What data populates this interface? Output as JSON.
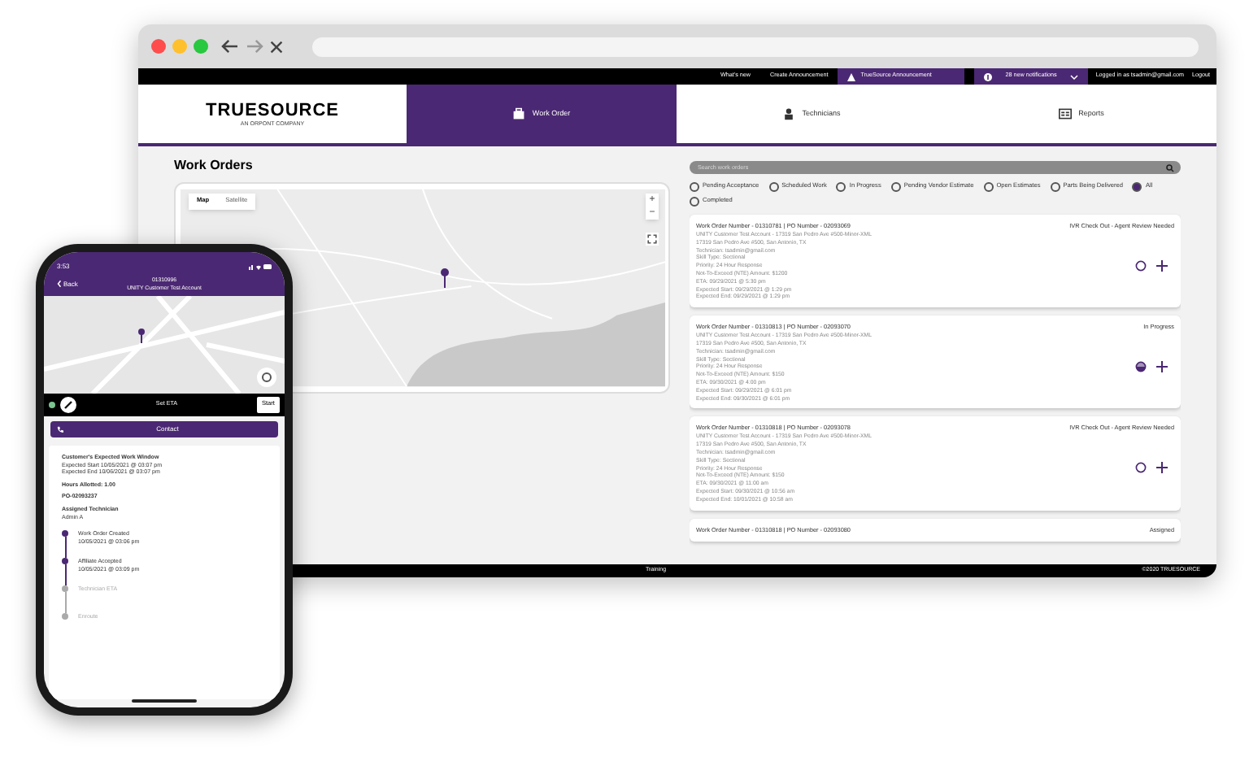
{
  "top_bar": {
    "links": [
      "What's new",
      "Create Announcement"
    ],
    "announcement": "TrueSource Announcement",
    "notifications": "28 new notifications",
    "user": "Logged in as tsadmin@gmail.com",
    "logout": "Logout"
  },
  "logo": {
    "name": "TRUESOURCE",
    "tagline": "AN ORPONT COMPANY"
  },
  "nav": [
    {
      "label": "Work Order",
      "selected": true
    },
    {
      "label": "Technicians",
      "selected": false
    },
    {
      "label": "Reports",
      "selected": false
    }
  ],
  "page_title": "Work Orders",
  "map": {
    "tabs": [
      {
        "label": "Map",
        "selected": true
      },
      {
        "label": "Satellite",
        "selected": false
      }
    ],
    "zoom_in": "+",
    "zoom_out": "−"
  },
  "search": {
    "placeholder": "Search work orders"
  },
  "filters": [
    {
      "label": "Pending Acceptance",
      "selected": false
    },
    {
      "label": "Scheduled Work",
      "selected": false
    },
    {
      "label": "In Progress",
      "selected": false
    },
    {
      "label": "Pending Vendor Estimate",
      "selected": false
    },
    {
      "label": "Open Estimates",
      "selected": false
    },
    {
      "label": "Parts Being Delivered",
      "selected": false
    },
    {
      "label": "All",
      "selected": true
    },
    {
      "label": "Completed",
      "selected": false
    }
  ],
  "work_orders": [
    {
      "title": "Work Order Number - 01310781 | PO Number - 02093069",
      "status": "IVR Check Out - Agent Review Needed",
      "in_progress": false,
      "lines": [
        "UNITY Customer Test Account - 17319 San Pedro Ave #500-Minor-XML",
        "17319 San Pedro Ave #500, San Antonio, TX",
        "Technician: tsadmin@gmail.com",
        "Skill Type: Sectional",
        "Priority: 24 Hour Response",
        "Not-To-Exceed (NTE) Amount: $1200",
        "ETA: 09/29/2021 @ 5:30 pm",
        "Expected Start: 09/29/2021 @ 1:29 pm",
        "Expected End: 09/29/2021 @ 1:29 pm"
      ]
    },
    {
      "title": "Work Order Number - 01310813 | PO Number - 02093070",
      "status": "In Progress",
      "in_progress": true,
      "lines": [
        "UNITY Customer Test Account - 17319 San Pedro Ave #500-Minor-XML",
        "17319 San Pedro Ave #500, San Antonio, TX",
        "Technician: tsadmin@gmail.com",
        "Skill Type: Sectional",
        "Priority: 24 Hour Response",
        "Not-To-Exceed (NTE) Amount: $150",
        "ETA: 09/30/2021 @ 4:00 pm",
        "Expected Start: 09/29/2021 @ 6:01 pm",
        "Expected End: 09/30/2021 @ 6:01 pm"
      ]
    },
    {
      "title": "Work Order Number - 01310818 | PO Number - 02093078",
      "status": "IVR Check Out - Agent Review Needed",
      "in_progress": false,
      "lines": [
        "UNITY Customer Test Account - 17319 San Pedro Ave #500-Minor-XML",
        "17319 San Pedro Ave #500, San Antonio, TX",
        "Technician: tsadmin@gmail.com",
        "Skill Type: Sectional",
        "Priority: 24 Hour Response",
        "Not-To-Exceed (NTE) Amount: $150",
        "ETA: 09/30/2021 @ 11:00 am",
        "Expected Start: 09/30/2021 @ 10:56 am",
        "Expected End: 10/01/2021 @ 10:58 am"
      ]
    },
    {
      "title": "Work Order Number - 01310818 | PO Number - 02093080",
      "status": "Assigned"
    }
  ],
  "footer": {
    "center": "Training",
    "right": "©2020 TRUESOURCE"
  },
  "phone": {
    "time": "3:53",
    "back": "Back",
    "order_number": "01310996",
    "account": "UNITY Customer Test Account",
    "set_eta": "Set ETA",
    "start": "Start",
    "contact": "Contact",
    "window_title": "Customer's Expected Work Window",
    "expected_start": "Expected Start 10/05/2021 @ 03:07 pm",
    "expected_end": "Expected End 10/06/2021 @ 03:07 pm",
    "hours": "Hours Allotted: 1.00",
    "po": "PO-02093237",
    "tech_label": "Assigned Technician",
    "tech_name": "Admin A",
    "timeline": [
      {
        "label": "Work Order Created",
        "time": "10/05/2021 @ 03:06 pm",
        "done": true
      },
      {
        "label": "Affiliate Accepted",
        "time": "10/05/2021 @ 03:09 pm",
        "done": true
      },
      {
        "label": "Technician ETA",
        "done": false
      },
      {
        "label": "Enroute",
        "done": false
      }
    ]
  }
}
